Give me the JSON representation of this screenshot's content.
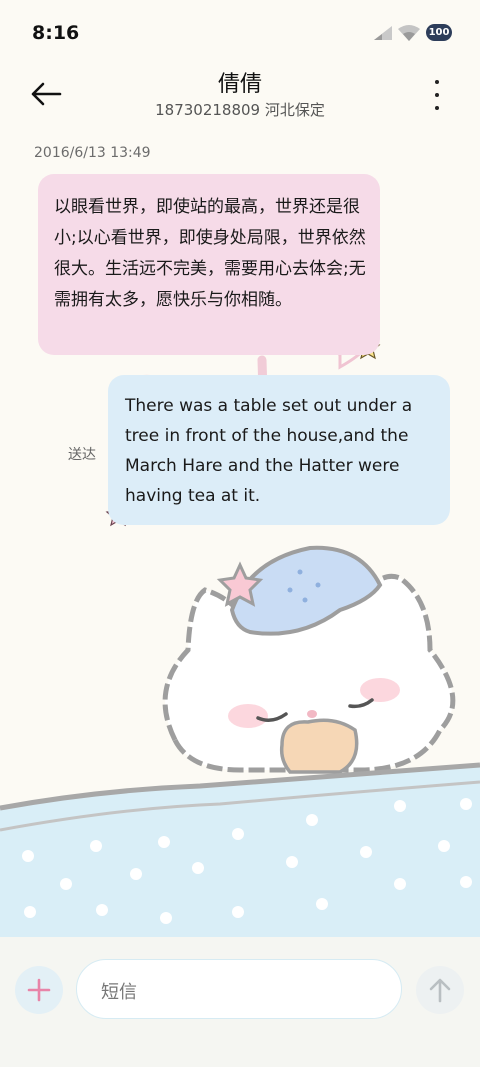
{
  "status_bar": {
    "time": "8:16",
    "battery": "100",
    "icons": [
      "signal-icon",
      "wifi-icon",
      "battery-icon"
    ]
  },
  "header": {
    "contact_name": "倩倩",
    "contact_detail": "18730218809 河北保定",
    "icons": [
      "back-arrow-icon",
      "more-vertical-icon"
    ]
  },
  "conversation": {
    "timestamp": "2016/6/13 13:49",
    "messages": [
      {
        "direction": "incoming",
        "text": "以眼看世界，即使站的最高，世界还是很小;以心看世界，即使身处局限，世界依然很大。生活远不完美，需要用心去体会;无需拥有太多，愿快乐与你相随。"
      },
      {
        "direction": "outgoing",
        "text": "There was a table set out under a tree in front of the house,and the March Hare and the Hatter were having tea at it.",
        "status": "送达"
      }
    ]
  },
  "composer": {
    "placeholder": "短信",
    "icons": [
      "add-icon",
      "send-arrow-icon"
    ]
  },
  "colors": {
    "background": "#fcfaf4",
    "incoming_bubble": "#f6dbe8",
    "outgoing_bubble": "#dcedf8",
    "accent_pink": "#e884a8",
    "blanket": "#d9eef7"
  }
}
